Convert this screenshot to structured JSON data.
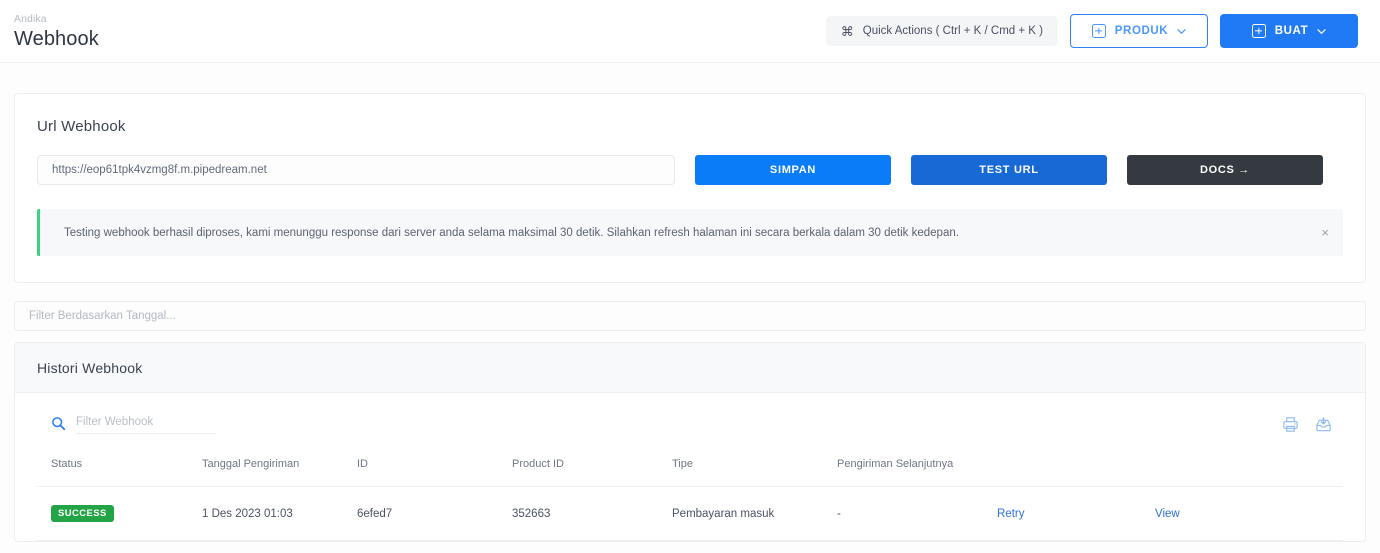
{
  "header": {
    "eyebrow": "Andika",
    "title": "Webhook",
    "quick_actions": "Quick Actions ( Ctrl + K / Cmd + K )",
    "quick_actions_glyph": "⌘",
    "produk_label": "PRODUK",
    "buat_label": "BUAT"
  },
  "url_section": {
    "title": "Url Webhook",
    "url_value": "https://eop61tpk4vzmg8f.m.pipedream.net",
    "url_placeholder": "https://",
    "save_label": "SIMPAN",
    "test_label": "TEST URL",
    "docs_label": "DOCS →"
  },
  "alert": {
    "message": "Testing webhook berhasil diproses, kami menunggu response dari server anda selama maksimal 30 detik. Silahkan refresh halaman ini secara berkala dalam 30 detik kedepan.",
    "close_glyph": "×",
    "accent_color": "#3ed17f"
  },
  "date_filter": {
    "placeholder": "Filter Berdasarkan Tanggal..."
  },
  "history": {
    "title": "Histori Webhook",
    "search_placeholder": "Filter Webhook",
    "columns": [
      "Status",
      "Tanggal Pengiriman",
      "ID",
      "Product ID",
      "Tipe",
      "Pengiriman Selanjutnya",
      "",
      ""
    ],
    "rows": [
      {
        "status": "SUCCESS",
        "tanggal": "1 Des 2023 01:03",
        "id": "6efed7",
        "product_id": "352663",
        "tipe": "Pembayaran masuk",
        "pengiriman_selanjutnya": "-",
        "retry_label": "Retry",
        "view_label": "View"
      }
    ]
  },
  "colors": {
    "primary_blue": "#2079f5",
    "save_blue": "#0b7cf8",
    "test_blue": "#1769d6",
    "docs_dark": "#343a40",
    "success_green": "#22a447",
    "link_blue": "#2f6fe0"
  }
}
